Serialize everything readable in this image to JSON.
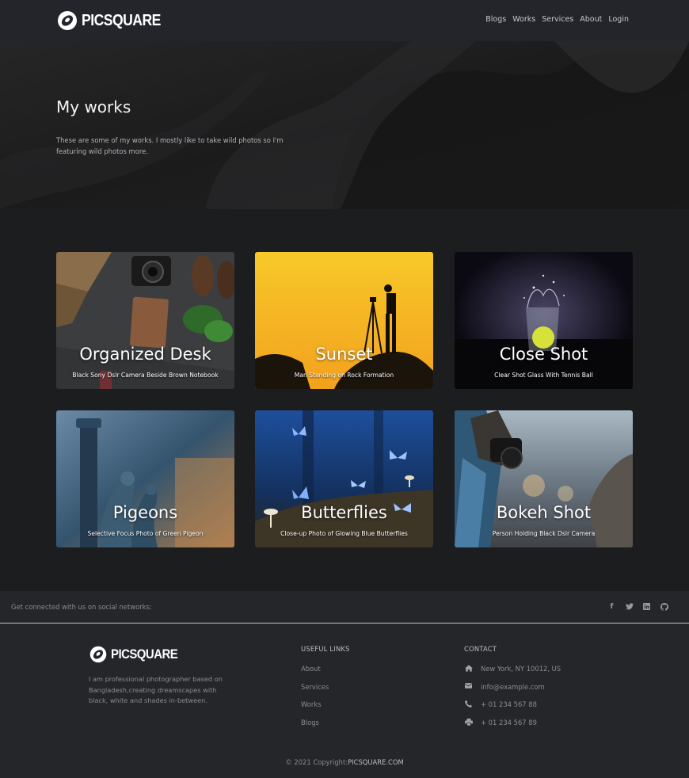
{
  "brand": {
    "name": "PICSQUARE"
  },
  "nav": {
    "items": [
      {
        "label": "Blogs"
      },
      {
        "label": "Works"
      },
      {
        "label": "Services"
      },
      {
        "label": "About"
      },
      {
        "label": "Login"
      }
    ]
  },
  "hero": {
    "title": "My works",
    "text": "These are some of my works. I mostly like to take wild photos so I'm featuring wild photos more."
  },
  "gallery": [
    {
      "title": "Organized Desk",
      "caption": "Black Sony Dslr Camera Beside Brown Notebook"
    },
    {
      "title": "Sunset",
      "caption": "Man Standing on Rock Formation"
    },
    {
      "title": "Close Shot",
      "caption": "Clear Shot Glass With Tennis Ball"
    },
    {
      "title": "Pigeons",
      "caption": "Selective Focus Photo of Green Pigeon"
    },
    {
      "title": "Butterflies",
      "caption": "Close-up Photo of Glowing Blue Butterflies"
    },
    {
      "title": "Bokeh Shot",
      "caption": "Person Holding Black Dslr Camera"
    }
  ],
  "social": {
    "text": "Get connected with us on social networks:",
    "icons": [
      "facebook-icon",
      "twitter-icon",
      "linkedin-icon",
      "github-icon"
    ]
  },
  "footer": {
    "about": "I am professional photographer based on Bangladesh,creating dreamscapes with black, white and shades in-between.",
    "links_heading": "USEFUL LINKS",
    "links": [
      "About",
      "Services",
      "Works",
      "Blogs"
    ],
    "contact_heading": "CONTACT",
    "contact": {
      "address": "New York, NY 10012, US",
      "email": "info@example.com",
      "phone": "+ 01 234 567 88",
      "fax": "+ 01 234 567 89"
    },
    "copyright_prefix": "© 2021 Copyright:",
    "copyright_brand": "PICSQUARE.COM"
  }
}
